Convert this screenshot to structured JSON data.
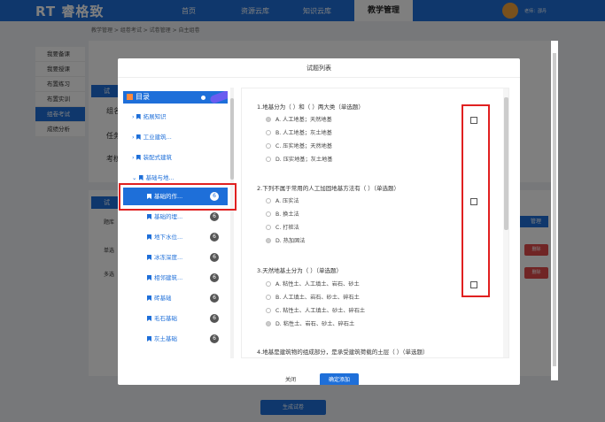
{
  "app": {
    "logo": "RT 睿格致",
    "nav": [
      "首页",
      "资源云库",
      "知识云库",
      "教学管理"
    ],
    "user": "老师：邵丹"
  },
  "breadcrumb": "教学管理 > 组卷考试 > 试卷管理 > 自主组卷",
  "sidebar": [
    "我要备课",
    "我要授课",
    "布置练习",
    "布置实训",
    "组卷考试",
    "成绩分析"
  ],
  "background": {
    "sec1": "试",
    "row_labels": [
      "组名",
      "任务",
      "考核"
    ],
    "sec2": "试",
    "table_label": "题库",
    "table_rows": [
      "单选",
      "多选"
    ],
    "delete_label": "删除",
    "manage_label": "管理",
    "generate_button": "生成试卷"
  },
  "modal": {
    "title": "试题列表",
    "cancel_button": "关闭",
    "add_button": "确定添加",
    "catalog": {
      "header": "目录",
      "items": [
        {
          "label": "拓展知识",
          "level": 1,
          "expanded": false
        },
        {
          "label": "工业建筑...",
          "level": 1,
          "expanded": false
        },
        {
          "label": "装配式建筑",
          "level": 1,
          "expanded": false
        },
        {
          "label": "基础与地...",
          "level": 1,
          "expanded": true
        },
        {
          "label": "基础的作...",
          "level": 2,
          "count": "6",
          "selected": true
        },
        {
          "label": "基础的埋...",
          "level": 2,
          "count": "6"
        },
        {
          "label": "地下水位...",
          "level": 2,
          "count": "6"
        },
        {
          "label": "冰冻深度...",
          "level": 2,
          "count": "6"
        },
        {
          "label": "相邻建筑...",
          "level": 2,
          "count": "6"
        },
        {
          "label": "砖基础",
          "level": 2,
          "count": "6"
        },
        {
          "label": "毛石基础",
          "level": 2,
          "count": "6"
        },
        {
          "label": "灰土基础",
          "level": 2,
          "count": "6"
        }
      ]
    },
    "questions": [
      {
        "title": "1.地基分为（ ）和（ ）两大类（单选题）",
        "options": [
          "A. 人工地基；天然地基",
          "B. 人工地基；灰土地基",
          "C. 压实地基；天然地基",
          "D. 压实地基；灰土地基"
        ],
        "selected_index": 0
      },
      {
        "title": "2.下列不属于常用的人工加固地基方法有（ ）（单选题）",
        "options": [
          "A. 压实法",
          "B. 换土法",
          "C. 打桩法",
          "D. 热加固法"
        ],
        "selected_index": 3
      },
      {
        "title": "3.天然地基土分为（ ）（单选题）",
        "options": [
          "A. 粘性土、人工填土、岩石、砂土",
          "B. 人工填土、岩石、砂土、碎石土",
          "C. 粘性土、人工填土、砂土、碎石土",
          "D. 粘性土、岩石、砂土、碎石土"
        ],
        "selected_index": 3
      },
      {
        "title": "4.地基是建筑物的组成部分，是承受建筑荷载的土层（ ）（单选题）",
        "options": [],
        "selected_index": -1
      }
    ]
  }
}
